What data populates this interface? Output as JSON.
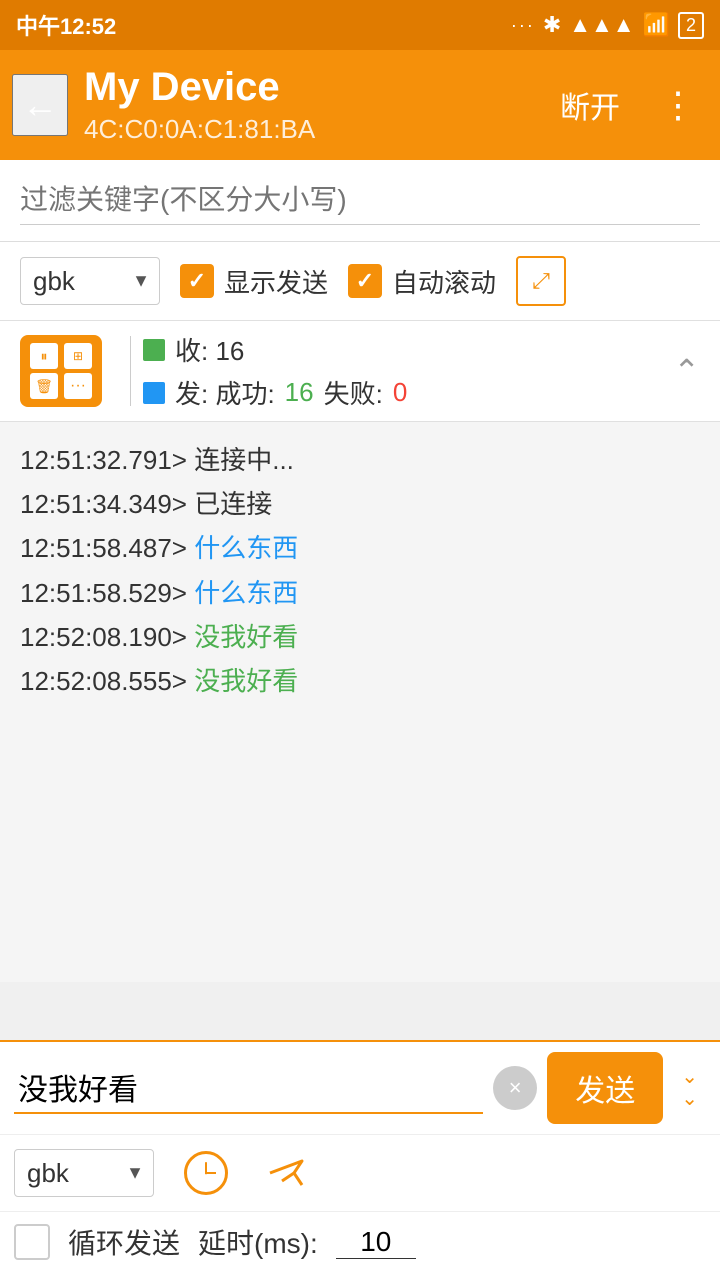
{
  "statusBar": {
    "time": "中午12:52",
    "icons": [
      "signal-dots",
      "bluetooth",
      "signal-bars",
      "wifi",
      "battery"
    ]
  },
  "toolbar": {
    "back_label": "←",
    "title": "My Device",
    "subtitle": "4C:C0:0A:C1:81:BA",
    "disconnect_label": "断开",
    "more_label": "⋮"
  },
  "filter": {
    "placeholder": "过滤关键字(不区分大小写)"
  },
  "controls": {
    "encoding": "gbk",
    "show_send_label": "显示发送",
    "auto_scroll_label": "自动滚动",
    "expand_label": "⤢"
  },
  "stats": {
    "recv_label": "收: 16",
    "send_label": "发: 成功: 16 失败: 0",
    "success_count": "16",
    "fail_count": "0"
  },
  "log": {
    "lines": [
      {
        "timestamp": "12:51:32.791>",
        "message": " 连接中...",
        "color": "default"
      },
      {
        "timestamp": "12:51:34.349>",
        "message": " 已连接",
        "color": "default"
      },
      {
        "timestamp": "12:51:58.487>",
        "message": " 什么东西",
        "color": "blue"
      },
      {
        "timestamp": "12:51:58.529>",
        "message": " 什么东西",
        "color": "blue"
      },
      {
        "timestamp": "12:52:08.190>",
        "message": " 没我好看",
        "color": "green"
      },
      {
        "timestamp": "12:52:08.555>",
        "message": " 没我好看",
        "color": "green"
      }
    ]
  },
  "input": {
    "value": "没我好看",
    "send_label": "发送",
    "clear_label": "×",
    "collapse_label": "❯❯"
  },
  "inputOptions": {
    "encoding": "gbk",
    "history_icon": "clock",
    "send_template_icon": "send"
  },
  "loopRow": {
    "label": "循环发送",
    "delay_label": "延时(ms):",
    "delay_value": "10"
  }
}
